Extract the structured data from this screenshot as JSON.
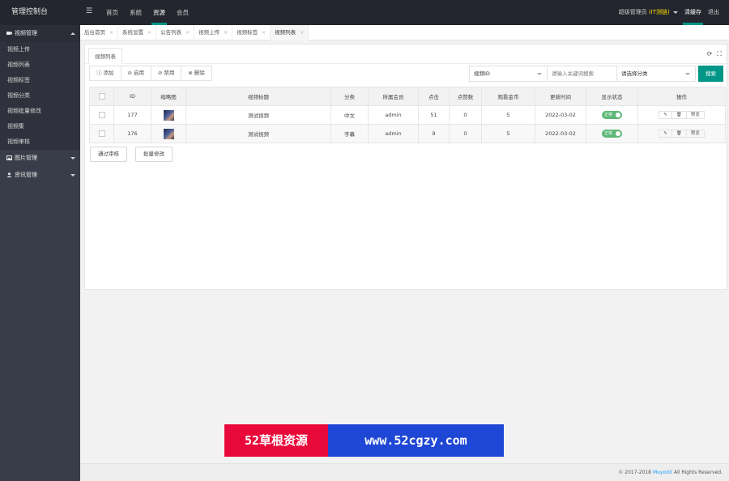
{
  "header": {
    "logo": "管理控制台",
    "menu_icon": "hamburger-icon",
    "nav": [
      "首页",
      "系统",
      "资源",
      "会员"
    ],
    "active_nav": "资源",
    "user": "(IT测链)",
    "admin_label": "超级管理员",
    "clear_cache": "清缓存",
    "logout": "退出"
  },
  "sidebar": {
    "group1": "视频管理",
    "group1_items": [
      "视频上传",
      "视频列表",
      "视频标签",
      "视频分类",
      "视频批量修改",
      "视频集",
      "视频审核"
    ],
    "group2": "图片管理",
    "group3": "资讯管理"
  },
  "tabs": [
    {
      "label": "后台首页"
    },
    {
      "label": "系统设置"
    },
    {
      "label": "公告列表"
    },
    {
      "label": "视频上传"
    },
    {
      "label": "视频标签"
    },
    {
      "label": "视频列表"
    }
  ],
  "card": {
    "tab_label": "视频列表",
    "toolbar": {
      "add": "添加",
      "enable": "启用",
      "disable": "禁用",
      "delete": "删除"
    },
    "search": {
      "field_select": "视频ID",
      "keyword_placeholder": "请输入关键词搜索",
      "category_select": "请选择分类",
      "button": "搜索"
    },
    "columns": [
      "ID",
      "缩略图",
      "视频标题",
      "分类",
      "所属会员",
      "点击",
      "点赞数",
      "观看金币",
      "更新时间",
      "显示状态",
      "操作"
    ],
    "rows": [
      {
        "id": "177",
        "title": "测试视频",
        "category": "中文",
        "member": "admin",
        "clicks": "51",
        "likes": "0",
        "coins": "5",
        "updated": "2022-03-02",
        "status": "正常"
      },
      {
        "id": "176",
        "title": "测试视频",
        "category": "字幕",
        "member": "admin",
        "clicks": "9",
        "likes": "0",
        "coins": "5",
        "updated": "2022-03-02",
        "status": "正常"
      }
    ],
    "row_ops": {
      "edit": "✎",
      "delete": "🗑",
      "view": "预览"
    },
    "bottom": {
      "batch_review": "通过审核",
      "batch_edit": "批量修改"
    }
  },
  "watermark": {
    "left": "52草根资源",
    "right": "www.52cgzy.com"
  },
  "footer": {
    "copyright": "© 2017-2018",
    "brand": "MuyodX",
    "rights": "All Rights Reserved."
  },
  "colors": {
    "accent": "#009688",
    "sidebar": "#393d49",
    "header": "#23262e",
    "switch": "#5fb878"
  }
}
